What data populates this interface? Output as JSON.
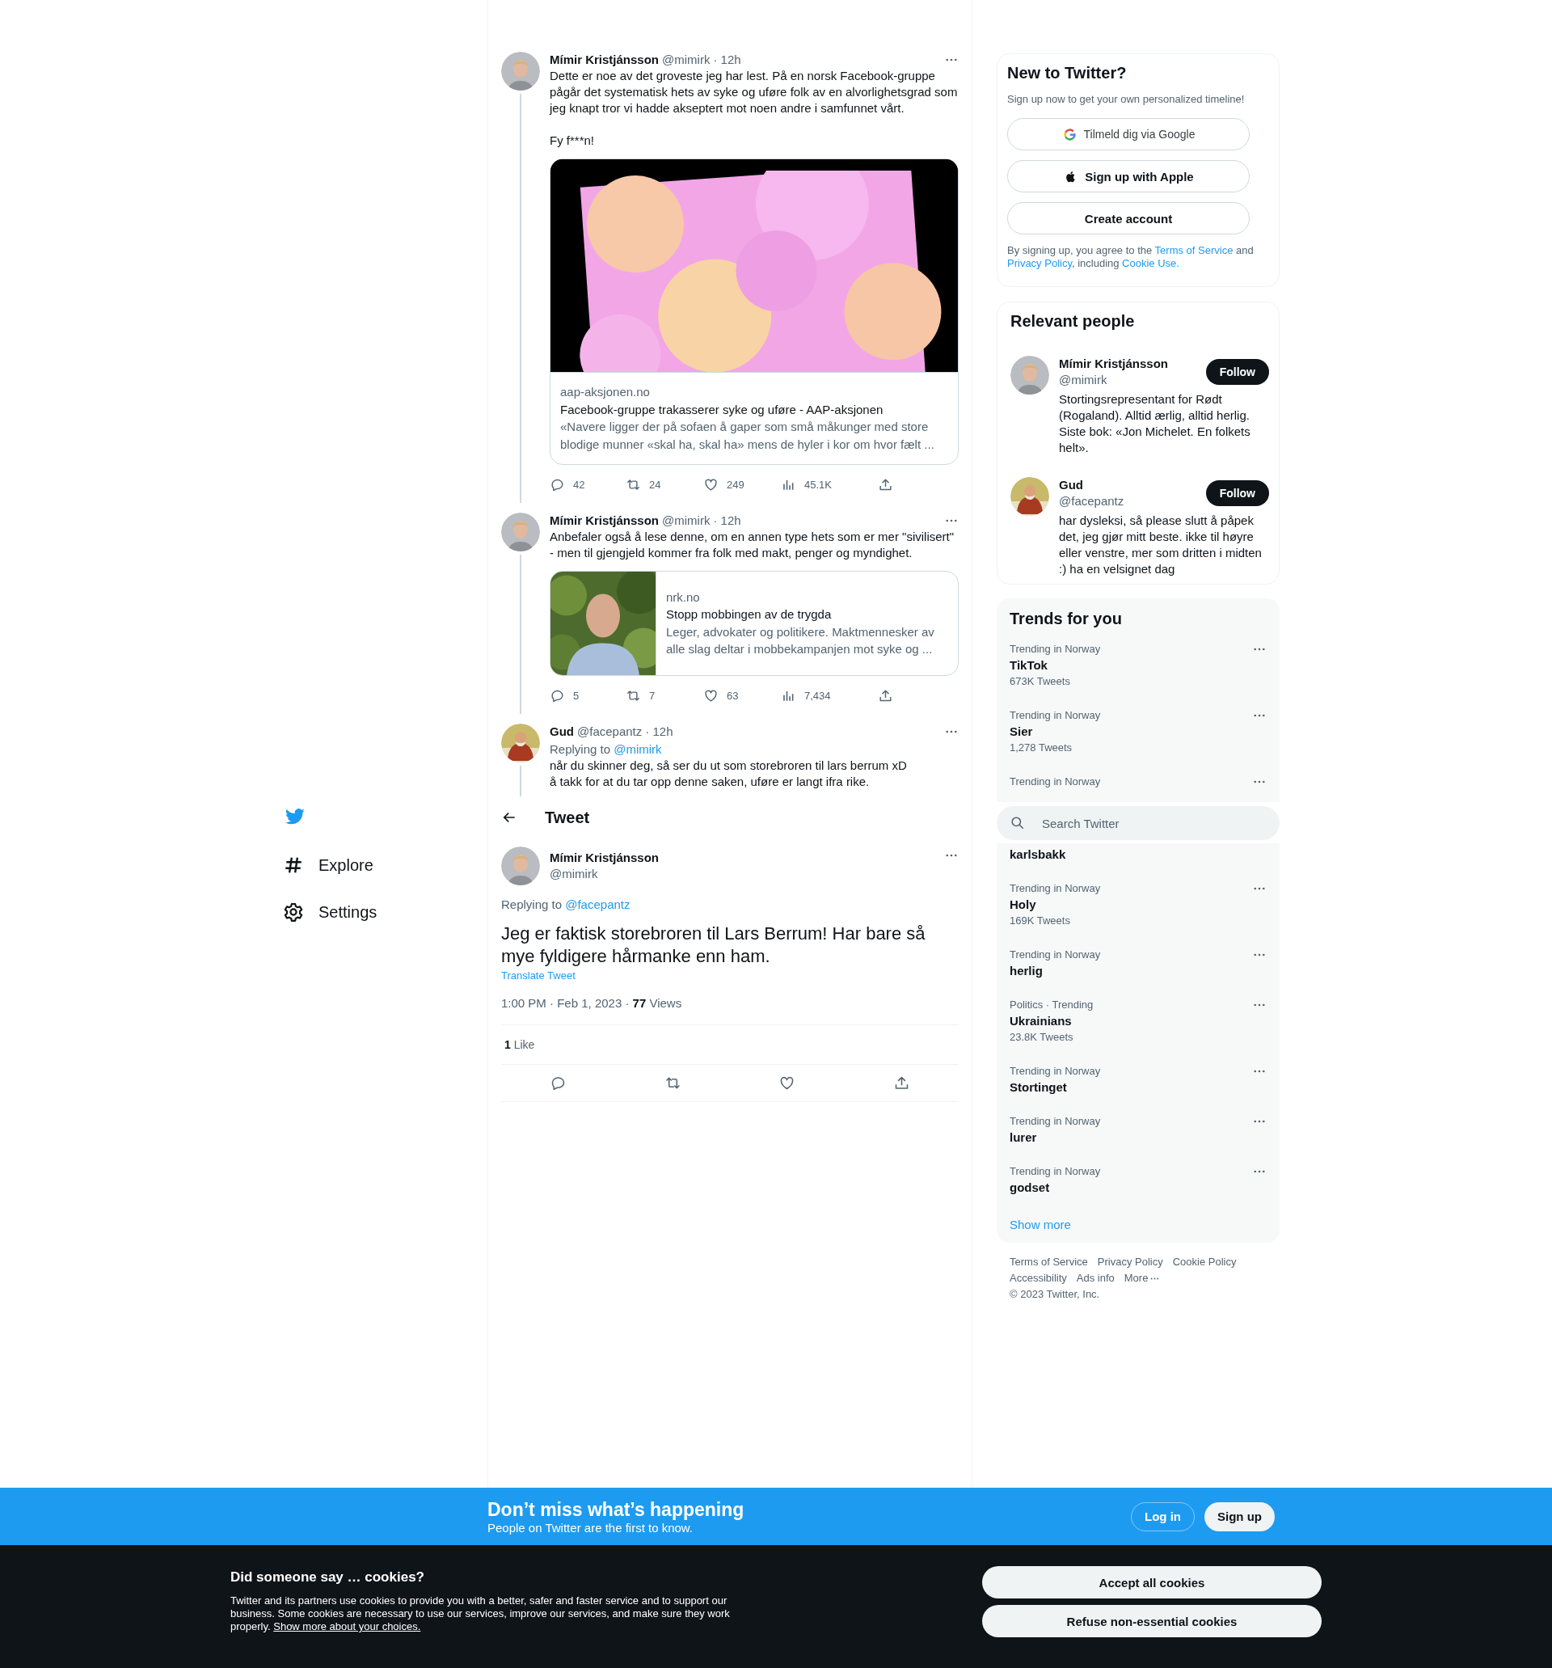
{
  "nav": {
    "items": [
      {
        "kind": "explore",
        "label": "Explore"
      },
      {
        "kind": "settings",
        "label": "Settings"
      }
    ]
  },
  "thread": [
    {
      "name": "Mímir Kristjánsson",
      "handle": "@mimirk",
      "time": "· 12h",
      "text": "Dette er noe av det groveste jeg har lest. På en norsk Facebook-gruppe pågår det systematisk hets av syke og uføre folk av en alvorlighetsgrad som jeg knapt tror vi hadde akseptert mot noen andre i samfunnet vårt.\n\nFy f***n!",
      "card": {
        "kind": "large_image",
        "domain": "aap-aksjonen.no",
        "title": "Facebook-gruppe trakasserer syke og uføre - AAP-aksjonen",
        "description": "«Navere ligger der på sofaen å gaper som små måkunger med store blodige munner «skal ha, skal ha» mens de hyler i kor om hvor fælt ..."
      },
      "actions": [
        {
          "kind": "reply",
          "count": "42"
        },
        {
          "kind": "retweet",
          "count": "24"
        },
        {
          "kind": "like",
          "count": "249"
        },
        {
          "kind": "views",
          "count": "45.1K"
        },
        {
          "kind": "share"
        }
      ]
    },
    {
      "name": "Mímir Kristjánsson",
      "handle": "@mimirk",
      "time": "· 12h",
      "text": "Anbefaler også å lese denne, om en annen type hets som er mer \"sivilisert\" - men til gjengjeld kommer fra folk med makt, penger og myndighet.",
      "card": {
        "kind": "thumbnail",
        "domain": "nrk.no",
        "title": "Stopp mobbingen av de trygda",
        "description": "Leger, advokater og politikere. Maktmennesker av alle slag deltar i mobbekampanjen mot syke og ..."
      },
      "actions": [
        {
          "kind": "reply",
          "count": "5"
        },
        {
          "kind": "retweet",
          "count": "7"
        },
        {
          "kind": "like",
          "count": "63"
        },
        {
          "kind": "views",
          "count": "7,434"
        },
        {
          "kind": "share"
        }
      ]
    },
    {
      "name": "Gud",
      "handle": "@facepantz",
      "time": "· 12h",
      "replying_to": {
        "label": "Replying to",
        "handle": "@mimirk"
      },
      "text": "når du skinner deg, så ser du ut som storebroren til lars berrum xD\nå takk for at du tar opp denne saken, uføre er langt ifra rike."
    }
  ],
  "header": {
    "title": "Tweet"
  },
  "main_tweet": {
    "name": "Mímir Kristjánsson",
    "handle": "@mimirk",
    "replying_to": {
      "label": "Replying to",
      "handle": "@facepantz"
    },
    "text": "Jeg er faktisk storebroren til Lars Berrum! Har bare så mye fyldigere hårmanke enn ham.",
    "translate": "Translate Tweet",
    "meta": "1:00 PM · Feb 1, 2023 · **77** Views",
    "likes": "**1** Like",
    "actions": [
      {
        "kind": "reply"
      },
      {
        "kind": "retweet"
      },
      {
        "kind": "like"
      },
      {
        "kind": "share"
      }
    ]
  },
  "signup": {
    "title": "New to Twitter?",
    "subtitle": "Sign up now to get your own personalized timeline!",
    "buttons": [
      {
        "kind": "google",
        "label": "Tilmeld dig via Google"
      },
      {
        "kind": "apple",
        "label": "Sign up with Apple"
      },
      {
        "kind": "create",
        "label": "Create account"
      }
    ],
    "legal": [
      {
        "text": "By signing up, you agree to the ",
        "link": false
      },
      {
        "text": "Terms of Service",
        "link": true
      },
      {
        "text": " and ",
        "link": false
      },
      {
        "text": "Privacy Policy",
        "link": true
      },
      {
        "text": ", including ",
        "link": false
      },
      {
        "text": "Cookie Use.",
        "link": true
      }
    ]
  },
  "relevant_people": {
    "title": "Relevant people",
    "people": [
      {
        "name": "Mímir Kristjánsson",
        "handle": "@mimirk",
        "bio": "Stortingsrepresentant for Rødt (Rogaland). Alltid ærlig, alltid herlig. Siste bok: «Jon Michelet. En folkets helt».",
        "button": "Follow"
      },
      {
        "name": "Gud",
        "handle": "@facepantz",
        "bio": "har dysleksi, så please slutt å påpek det, jeg gjør mitt beste. ikke til høyre eller venstre, mer som dritten i midten :) ha en velsignet dag",
        "button": "Follow"
      }
    ]
  },
  "trends": {
    "title": "Trends for you",
    "items_above": [
      {
        "category": "Trending in Norway",
        "name": "TikTok",
        "count": "673K Tweets"
      },
      {
        "category": "Trending in Norway",
        "name": "Sier",
        "count": "1,278 Tweets"
      },
      {
        "category": "Trending in Norway"
      }
    ],
    "items_below": [
      {
        "name": "karlsbakk"
      },
      {
        "category": "Trending in Norway",
        "name": "Holy",
        "count": "169K Tweets"
      },
      {
        "category": "Trending in Norway",
        "name": "herlig"
      },
      {
        "category": "Politics · Trending",
        "name": "Ukrainians",
        "count": "23.8K Tweets"
      },
      {
        "category": "Trending in Norway",
        "name": "Stortinget"
      },
      {
        "category": "Trending in Norway",
        "name": "lurer"
      },
      {
        "category": "Trending in Norway",
        "name": "godset"
      }
    ],
    "show_more": "Show more"
  },
  "search": {
    "placeholder": "Search Twitter"
  },
  "footer": {
    "links": [
      "Terms of Service",
      "Privacy Policy",
      "Cookie Policy",
      "Accessibility",
      "Ads info"
    ],
    "more": "More",
    "copyright": "© 2023 Twitter, Inc."
  },
  "banner": {
    "title": "Don’t miss what’s happening",
    "subtitle": "People on Twitter are the first to know.",
    "buttons": [
      {
        "kind": "outline",
        "label": "Log in"
      },
      {
        "kind": "solid",
        "label": "Sign up"
      }
    ]
  },
  "cookies": {
    "title": "Did someone say … cookies?",
    "text": "Twitter and its partners use cookies to provide you with a better, safer and faster service and to support our business. Some cookies are necessary to use our services, improve our services, and make sure they work properly. ",
    "link": "Show more about your choices.",
    "buttons": [
      "Accept all cookies",
      "Refuse non-essential cookies"
    ]
  }
}
